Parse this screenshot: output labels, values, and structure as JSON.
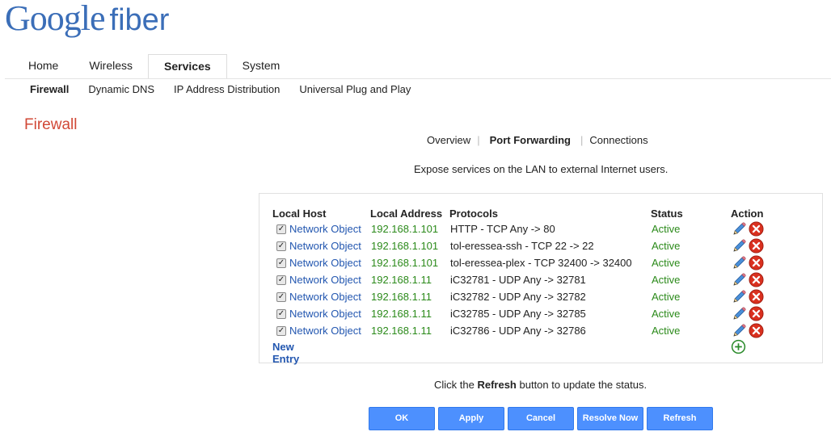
{
  "brand": {
    "word1": "Google",
    "word2": "fiber",
    "color": "#3b6eb8"
  },
  "main_tabs": [
    {
      "label": "Home"
    },
    {
      "label": "Wireless"
    },
    {
      "label": "Services",
      "active": true
    },
    {
      "label": "System"
    }
  ],
  "sub_tabs": [
    {
      "label": "Firewall",
      "active": true
    },
    {
      "label": "Dynamic DNS"
    },
    {
      "label": "IP Address Distribution"
    },
    {
      "label": "Universal Plug and Play"
    }
  ],
  "page_title": "Firewall",
  "view_tabs": [
    {
      "label": "Overview"
    },
    {
      "label": "Port Forwarding",
      "active": true
    },
    {
      "label": "Connections"
    }
  ],
  "description": "Expose services on the LAN to external Internet users.",
  "table": {
    "headers": {
      "local_host": "Local Host",
      "local_address": "Local Address",
      "protocols": "Protocols",
      "status": "Status",
      "action": "Action"
    },
    "rows": [
      {
        "checked": true,
        "host": "Network Object",
        "address": "192.168.1.101",
        "protocol": "HTTP - TCP Any -> 80",
        "status": "Active"
      },
      {
        "checked": true,
        "host": "Network Object",
        "address": "192.168.1.101",
        "protocol": "tol-eressea-ssh - TCP 22 -> 22",
        "status": "Active"
      },
      {
        "checked": true,
        "host": "Network Object",
        "address": "192.168.1.101",
        "protocol": "tol-eressea-plex - TCP 32400 -> 32400",
        "status": "Active"
      },
      {
        "checked": true,
        "host": "Network Object",
        "address": "192.168.1.11",
        "protocol": "iC32781 - UDP Any -> 32781",
        "status": "Active"
      },
      {
        "checked": true,
        "host": "Network Object",
        "address": "192.168.1.11",
        "protocol": "iC32782 - UDP Any -> 32782",
        "status": "Active"
      },
      {
        "checked": true,
        "host": "Network Object",
        "address": "192.168.1.11",
        "protocol": "iC32785 - UDP Any -> 32785",
        "status": "Active"
      },
      {
        "checked": true,
        "host": "Network Object",
        "address": "192.168.1.11",
        "protocol": "iC32786 - UDP Any -> 32786",
        "status": "Active"
      }
    ],
    "new_entry": "New Entry",
    "row_icons": [
      "pencil-icon",
      "delete-x-icon"
    ],
    "add_icon": "plus-circle-icon"
  },
  "hint": {
    "before": "Click the ",
    "strong": "Refresh",
    "after": " button to update the status."
  },
  "buttons": {
    "ok": "OK",
    "apply": "Apply",
    "cancel": "Cancel",
    "resolve_now": "Resolve Now",
    "refresh": "Refresh"
  },
  "colors": {
    "accent_blue": "#4d90fe",
    "link_blue": "#2357b0",
    "status_green": "#2b8a1a",
    "title_red": "#d14836",
    "delete_red": "#d9301f",
    "add_green": "#2a8a2a"
  }
}
